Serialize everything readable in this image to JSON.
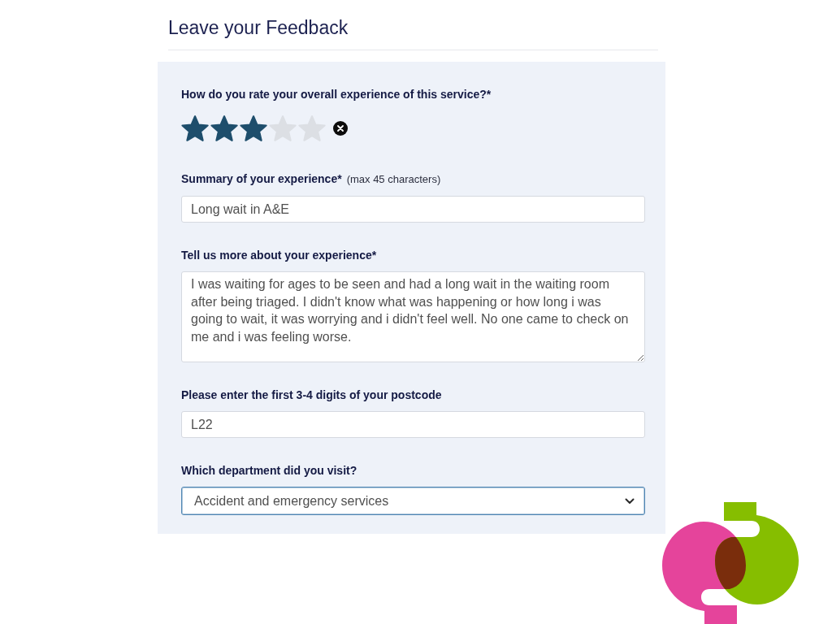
{
  "title": "Leave your Feedback",
  "form": {
    "fields": [
      {
        "kind": "rating",
        "label": "How do you rate your overall experience of this service?*",
        "stars": 3
      },
      {
        "kind": "text",
        "label": "Summary of your experience*",
        "hint": "(max 45 characters)",
        "value": "Long wait in A&E",
        "focused": false
      },
      {
        "kind": "textarea",
        "label": "Tell us more about your experience*",
        "value": "I was waiting for ages to be seen and had a long wait in the waiting room after being triaged. I didn't know what was happening or how long i was going to wait, it was worrying and i didn't feel well. No one came to check on me and i was feeling worse.",
        "focused": false
      },
      {
        "kind": "text",
        "label": "Please enter the first 3-4 digits of your postcode",
        "value": "L22",
        "focused": false
      },
      {
        "kind": "select",
        "label": "Which department did you visit?",
        "value": "Accident and emergency services",
        "focused": true
      }
    ]
  }
}
